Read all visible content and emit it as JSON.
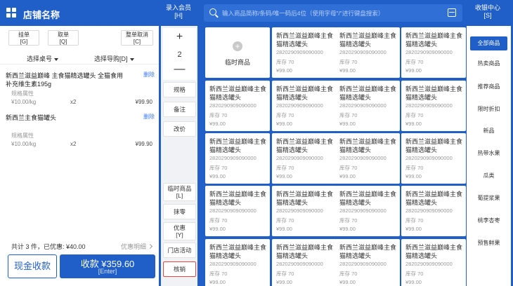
{
  "header": {
    "store_name": "店铺名称",
    "member_label": "录入会员",
    "member_key": "[H]",
    "search_placeholder": "输入商品简称/条码/唯一码后4位（使用字母\"/\"进行键盘搜索）",
    "cashier_label": "收银中心",
    "cashier_key": "[S]"
  },
  "order_actions": [
    {
      "label": "挂单",
      "key": "[G]"
    },
    {
      "label": "取单",
      "key": "[Q]"
    },
    {
      "label": "整单取消",
      "key": "[C]"
    }
  ],
  "selectors": {
    "table": "选择桌号",
    "guide": "选择导购[D]"
  },
  "cart": [
    {
      "name": "新西兰滋益巅峰 主食猫精选罐头 全猫食用补充维生素195g",
      "delete": "删除",
      "spec": "规格属性",
      "price": "¥10.00/kg",
      "qty": "x2",
      "total": "¥99.90"
    },
    {
      "name": "新西兰主食猫罐头",
      "delete": "删除",
      "spec": "规格属性",
      "price": "¥10.00/kg",
      "qty": "x2",
      "total": "¥99.90"
    }
  ],
  "summary": {
    "text": "共计 3 件，已优惠: ¥40.00",
    "detail": "优惠明细"
  },
  "payment": {
    "cash_label": "现金收款",
    "pay_amount": "收款 ¥359.60",
    "pay_key": "[Enter]"
  },
  "tools": {
    "qty_value": "2",
    "spec": "规格",
    "note": "备注",
    "change_price": "改价",
    "temp_item": "临时商品",
    "temp_item_key": "[L]",
    "round_off": "抹零",
    "discount": "优惠",
    "discount_key": "[Y]",
    "store_activity": "门店活动",
    "verify": "核销"
  },
  "temp_product": {
    "label": "临时商品"
  },
  "product": {
    "name": "新西兰滋益巅峰主食猫精选罐头",
    "code": "2820290909090000",
    "stock": "库存 70",
    "price": "¥99.00"
  },
  "categories": [
    "全部商品",
    "热卖商品",
    "推荐商品",
    "限时折扣",
    "新品",
    "热带水果",
    "瓜类",
    "葡提浆果",
    "桃李杏枣",
    "预售鲜果"
  ],
  "colors": {
    "primary": "#1f5fc7",
    "highlight": "#e8463b",
    "link": "#3a7bf0"
  }
}
